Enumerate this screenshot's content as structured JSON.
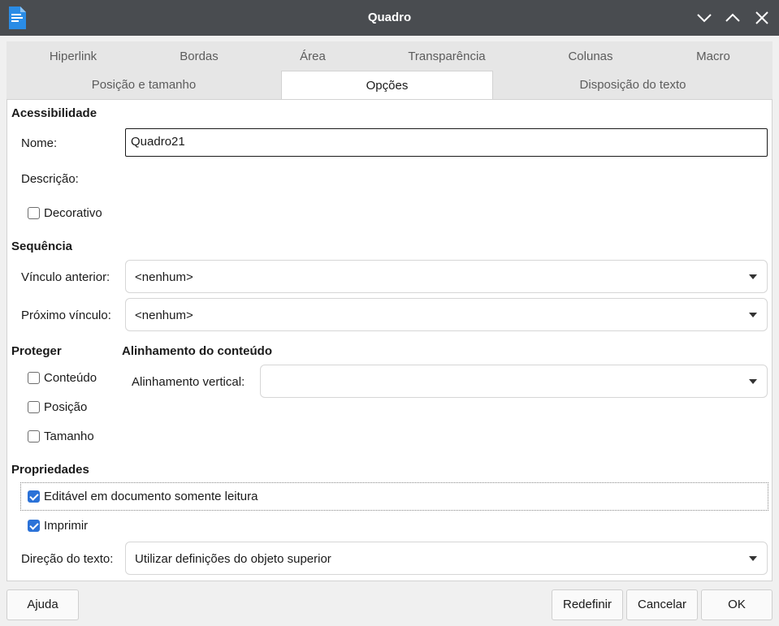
{
  "window": {
    "title": "Quadro",
    "icon": "document-icon",
    "controls": [
      "minimize-icon",
      "maximize-icon",
      "close-icon"
    ]
  },
  "tabs": {
    "row1": [
      "Hiperlink",
      "Bordas",
      "Área",
      "Transparência",
      "Colunas",
      "Macro"
    ],
    "row2": [
      "Posição e tamanho",
      "Opções",
      "Disposição do texto"
    ],
    "active": "Opções"
  },
  "accessibility": {
    "heading": "Acessibilidade",
    "name_label": "Nome:",
    "name_value": "Quadro21",
    "description_label": "Descrição:",
    "decorative_label": "Decorativo",
    "decorative_checked": false
  },
  "sequence": {
    "heading": "Sequência",
    "prev_label": "Vínculo anterior:",
    "prev_value": "<nenhum>",
    "next_label": "Próximo vínculo:",
    "next_value": "<nenhum>"
  },
  "protect": {
    "heading": "Proteger",
    "content_label": "Conteúdo",
    "position_label": "Posição",
    "size_label": "Tamanho"
  },
  "alignment": {
    "heading": "Alinhamento do conteúdo",
    "vertical_label": "Alinhamento vertical:",
    "vertical_value": ""
  },
  "properties": {
    "heading": "Propriedades",
    "editable_label": "Editável em documento somente leitura",
    "editable_checked": true,
    "print_label": "Imprimir",
    "print_checked": true,
    "direction_label": "Direção do texto:",
    "direction_value": "Utilizar definições do objeto superior"
  },
  "buttons": {
    "help": "Ajuda",
    "reset": "Redefinir",
    "cancel": "Cancelar",
    "ok": "OK"
  },
  "colors": {
    "titlebar": "#494c50",
    "accent": "#2b72d8",
    "dialog_bg": "#f0f0f0"
  }
}
